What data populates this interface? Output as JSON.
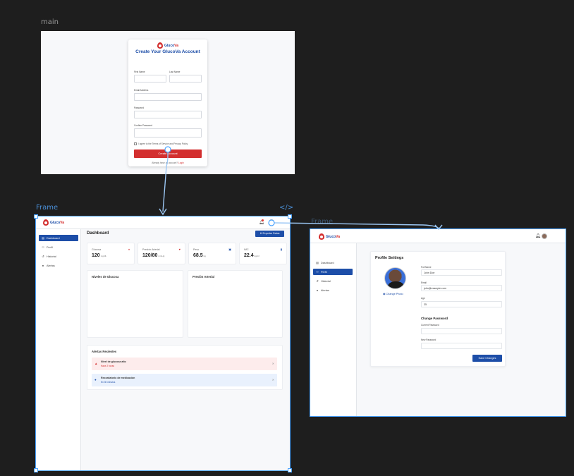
{
  "canvas": {
    "main_label": "main",
    "frame_label": "Frame",
    "frame2_label": "Frame",
    "code_icon": "</>"
  },
  "signup": {
    "brand_prefix": "Gluco",
    "brand_suffix": "Va",
    "title": "Create Your GlucoVa Account",
    "first_name_label": "First Name",
    "last_name_label": "Last Name",
    "email_label": "Email Address",
    "password_label": "Password",
    "confirm_label": "Confirm Password",
    "terms": "I agree to the Terms of Service and Privacy Policy",
    "create_button": "Create Account",
    "login_text": "Already have an account?",
    "login_link": "Login"
  },
  "dashboard": {
    "brand_prefix": "Gluco",
    "brand_suffix": "Va",
    "sidebar": [
      {
        "label": "Dashboard",
        "icon": "chart-icon",
        "active": true
      },
      {
        "label": "Perfil",
        "icon": "user-icon",
        "active": false
      },
      {
        "label": "Historial",
        "icon": "history-icon",
        "active": false
      },
      {
        "label": "Alertas",
        "icon": "bell-icon",
        "active": false
      }
    ],
    "title": "Dashboard",
    "export_button": "Exportar Datos",
    "stats": [
      {
        "label": "Glucosa",
        "value": "120",
        "unit": "mg/dL"
      },
      {
        "label": "Presión Arterial",
        "value": "120/80",
        "unit": "mmHg"
      },
      {
        "label": "Peso",
        "value": "68.5",
        "unit": "kg"
      },
      {
        "label": "IMC",
        "value": "22.4",
        "unit": "kg/m²"
      }
    ],
    "glucose_panel": "Niveles de Glucosa",
    "pressure_panel": "Presión Arterial",
    "alerts_title": "Alertas Recientes",
    "alerts": [
      {
        "title": "Nivel de glucosa alto",
        "sub": "Hace 2 horas",
        "kind": "warning"
      },
      {
        "title": "Recordatorio de medicación",
        "sub": "En 30 minutos",
        "kind": "info"
      }
    ]
  },
  "profile": {
    "brand_prefix": "Gluco",
    "brand_suffix": "Va",
    "sidebar": [
      {
        "label": "Dashboard",
        "active": false
      },
      {
        "label": "Perfil",
        "active": true
      },
      {
        "label": "Historial",
        "active": false
      },
      {
        "label": "Alertas",
        "active": false
      }
    ],
    "title": "Profile Settings",
    "change_photo": "Change Photo",
    "full_name_label": "Full Name",
    "full_name_value": "John Doe",
    "email_label": "Email",
    "email_value": "john@example.com",
    "age_label": "Age",
    "age_value": "35",
    "change_password_title": "Change Password",
    "current_password_label": "Current Password",
    "new_password_label": "New Password",
    "save_button": "Save Changes"
  },
  "colors": {
    "brand_blue": "#1d4ea8",
    "brand_red": "#d32f2f",
    "selection_blue": "#4aa3ff"
  }
}
